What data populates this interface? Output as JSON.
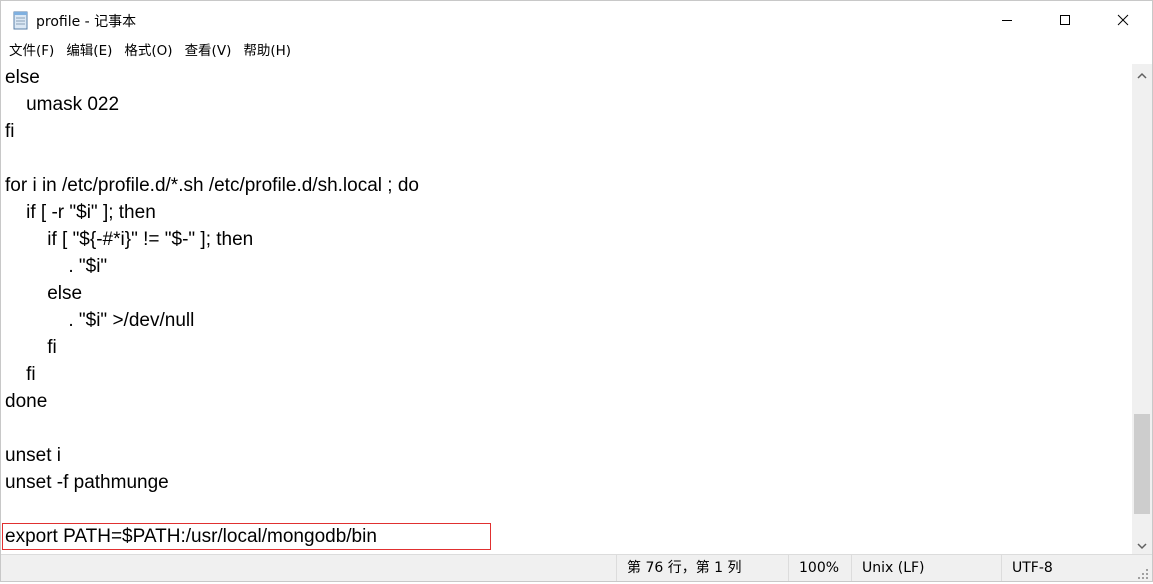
{
  "window": {
    "title": "profile - 记事本",
    "icon": "notepad-icon",
    "controls": [
      "minimize-icon",
      "maximize-icon",
      "close-icon"
    ]
  },
  "menubar": {
    "items": [
      "文件(F)",
      "编辑(E)",
      "格式(O)",
      "查看(V)",
      "帮助(H)"
    ]
  },
  "editor": {
    "lines": [
      "else",
      "    umask 022",
      "fi",
      "",
      "for i in /etc/profile.d/*.sh /etc/profile.d/sh.local ; do",
      "    if [ -r \"$i\" ]; then",
      "        if [ \"${-#*i}\" != \"$-\" ]; then",
      "            . \"$i\"",
      "        else",
      "            . \"$i\" >/dev/null",
      "        fi",
      "    fi",
      "done",
      "",
      "unset i",
      "unset -f pathmunge",
      "",
      "export PATH=$PATH:/usr/local/mongodb/bin"
    ],
    "highlight_color": "#e03030"
  },
  "statusbar": {
    "position": "第 76 行，第 1 列",
    "zoom": "100%",
    "line_ending": "Unix (LF)",
    "encoding": "UTF-8"
  }
}
